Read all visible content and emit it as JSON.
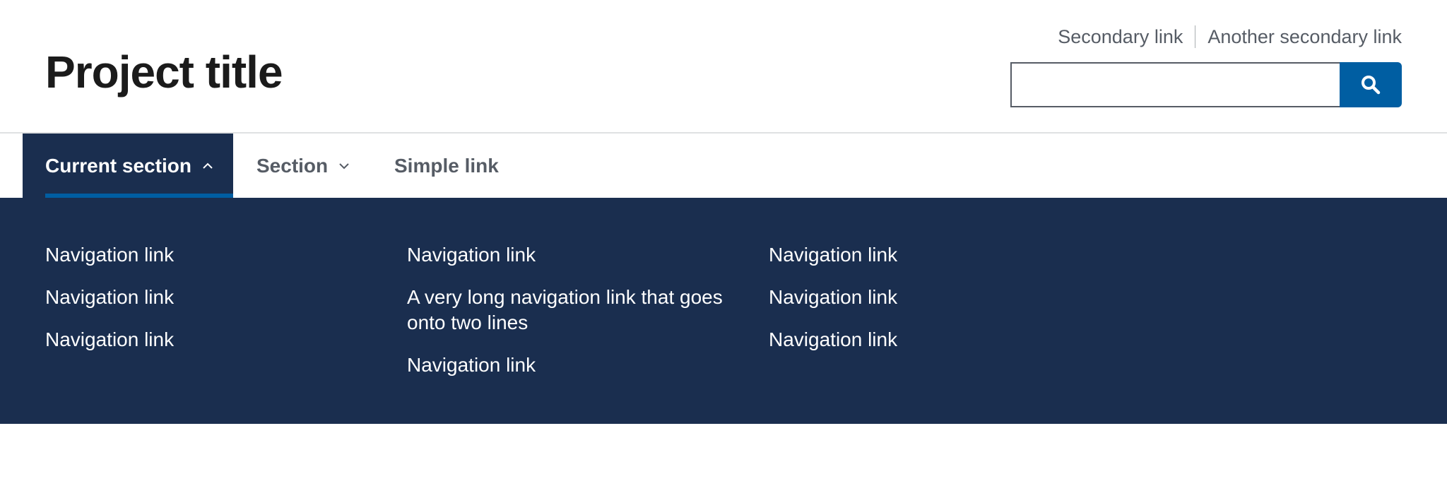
{
  "header": {
    "title": "Project title",
    "secondary_links": [
      "Secondary link",
      "Another secondary link"
    ],
    "search": {
      "placeholder": "",
      "button_icon": "search-icon"
    }
  },
  "nav": {
    "items": [
      {
        "label": "Current section",
        "icon": "chevron-up-icon",
        "state": "current"
      },
      {
        "label": "Section",
        "icon": "chevron-down-icon"
      },
      {
        "label": "Simple link"
      }
    ]
  },
  "megamenu": {
    "columns": [
      [
        "Navigation link",
        "Navigation link",
        "Navigation link"
      ],
      [
        "Navigation link",
        "A very long navigation link that goes onto two lines",
        "Navigation link"
      ],
      [
        "Navigation link",
        "Navigation link",
        "Navigation link"
      ]
    ]
  },
  "colors": {
    "primary": "#005ea2",
    "nav_bg": "#1a2e4f",
    "text": "#1b1b1b",
    "muted": "#565c65"
  }
}
